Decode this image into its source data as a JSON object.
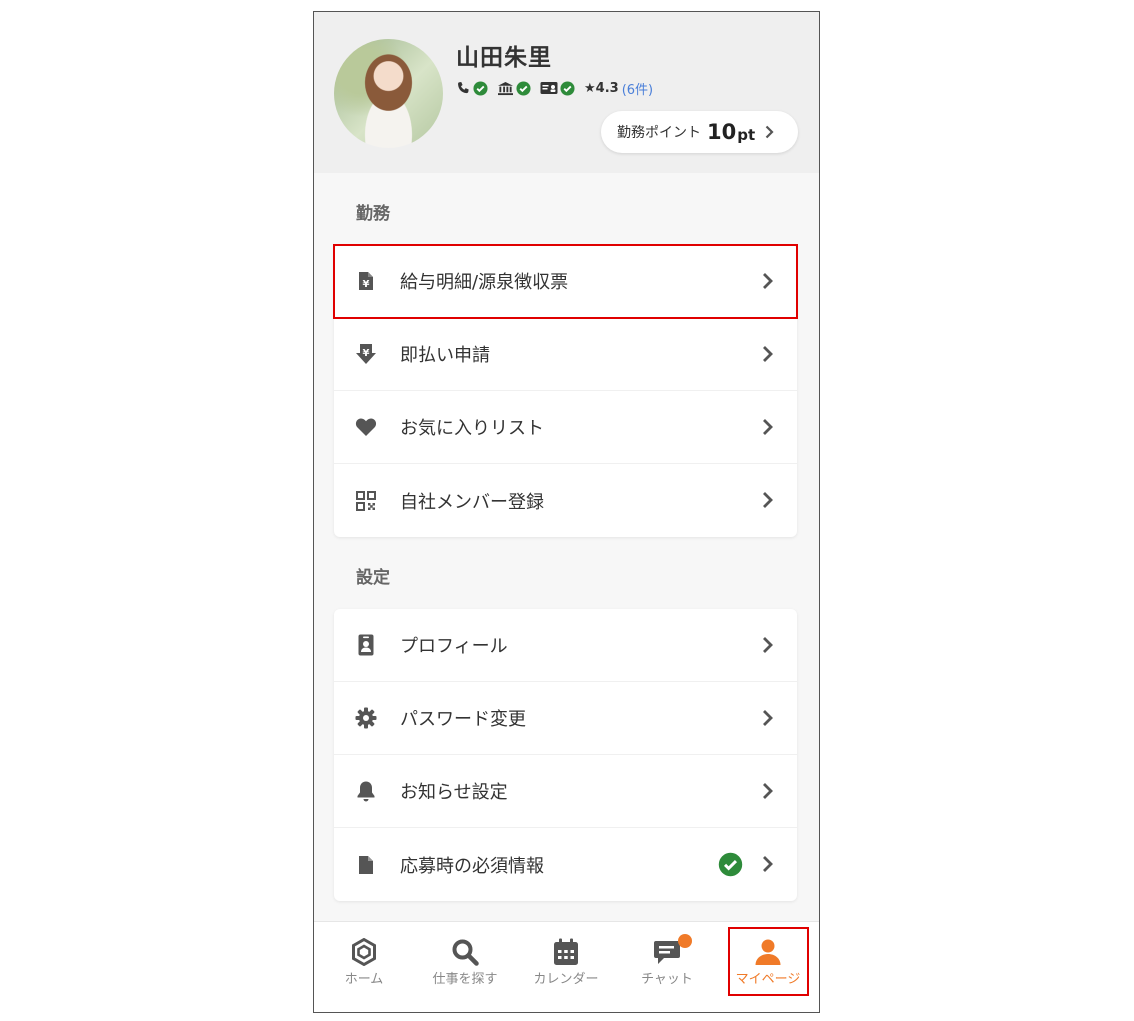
{
  "profile": {
    "name": "山田朱里",
    "rating": "★4.3",
    "review_count": "(6件)",
    "points_label": "勤務ポイント",
    "points_value": "10",
    "points_unit": "pt"
  },
  "sections": {
    "work": {
      "title": "勤務",
      "items": [
        {
          "label": "給与明細/源泉徴収票",
          "icon": "yen-document-icon"
        },
        {
          "label": "即払い申請",
          "icon": "yen-download-icon"
        },
        {
          "label": "お気に入りリスト",
          "icon": "heart-icon"
        },
        {
          "label": "自社メンバー登録",
          "icon": "qr-code-icon"
        }
      ]
    },
    "settings": {
      "title": "設定",
      "items": [
        {
          "label": "プロフィール",
          "icon": "id-badge-icon"
        },
        {
          "label": "パスワード変更",
          "icon": "gear-icon"
        },
        {
          "label": "お知らせ設定",
          "icon": "bell-icon"
        },
        {
          "label": "応募時の必須情報",
          "icon": "file-icon"
        }
      ]
    }
  },
  "tabs": [
    {
      "label": "ホーム",
      "icon": "home-hexagon-icon"
    },
    {
      "label": "仕事を探す",
      "icon": "search-icon"
    },
    {
      "label": "カレンダー",
      "icon": "calendar-icon"
    },
    {
      "label": "チャット",
      "icon": "chat-icon"
    },
    {
      "label": "マイページ",
      "icon": "user-icon",
      "active": true
    }
  ],
  "colors": {
    "accent": "#f07a28",
    "verified": "#2e8b3a",
    "link": "#4a7fd9",
    "highlight": "#e00000"
  }
}
